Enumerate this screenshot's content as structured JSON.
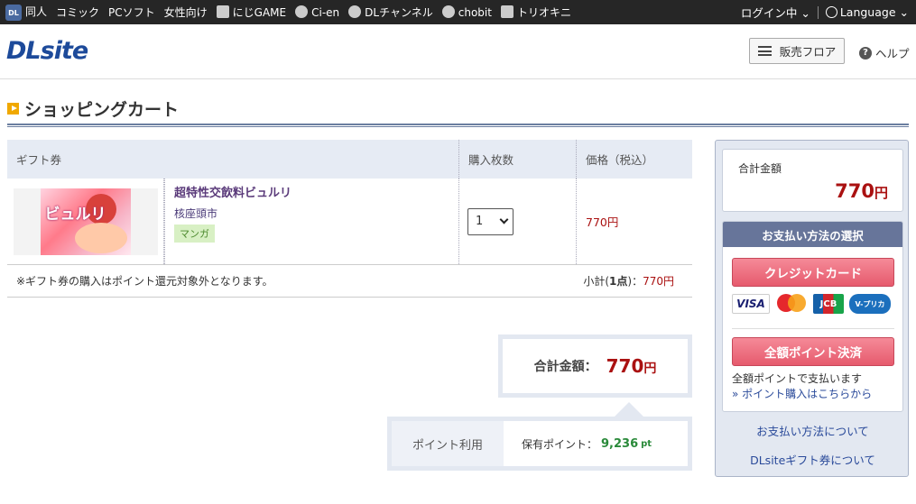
{
  "topbar": {
    "logo_text": "DL",
    "nav": [
      "同人",
      "コミック",
      "PCソフト",
      "女性向け",
      "にじGAME",
      "Ci-en",
      "DLチャンネル",
      "chobit",
      "トリオキニ"
    ],
    "login": "ログイン中",
    "language": "Language"
  },
  "header": {
    "logo": "DLsite",
    "floor_button": "販売フロア",
    "help": "ヘルプ"
  },
  "page": {
    "title": "ショッピングカート"
  },
  "cart": {
    "headers": {
      "item": "ギフト券",
      "qty": "購入枚数",
      "price": "価格（税込）"
    },
    "item": {
      "thumb_title": "ビュルリ",
      "title": "超特性交飲料ビュルリ",
      "circle": "核座頭市",
      "genre": "マンガ",
      "qty": "1",
      "price": "770円"
    },
    "note": "※ギフト券の購入はポイント還元対象外となります。",
    "subtotal_prefix": "小計(",
    "subtotal_count": "1点",
    "subtotal_suffix": ")：",
    "subtotal_value": "770円"
  },
  "total": {
    "label": "合計金額：",
    "value": "770",
    "unit": "円"
  },
  "points": {
    "label": "ポイント利用",
    "held_label": "保有ポイント：",
    "held_value": "9,236",
    "unit": "pt"
  },
  "side": {
    "total_label": "合計金額",
    "total_value": "770",
    "total_unit": "円",
    "payment_head": "お支払い方法の選択",
    "credit_button": "クレジットカード",
    "cards": [
      "VISA",
      "mastercard",
      "JCB",
      "V-プリカ"
    ],
    "point_button": "全額ポイント決済",
    "point_note": "全額ポイントで支払います",
    "point_link": "» ポイント購入はこちらから",
    "about_payment": "お支払い方法について",
    "about_gift": "DLsiteギフト券について"
  },
  "colors": {
    "accent_red": "#aa1111",
    "nav_bg": "#262626",
    "panel_bg": "#e3e8f1",
    "pay_head": "#67759a"
  }
}
